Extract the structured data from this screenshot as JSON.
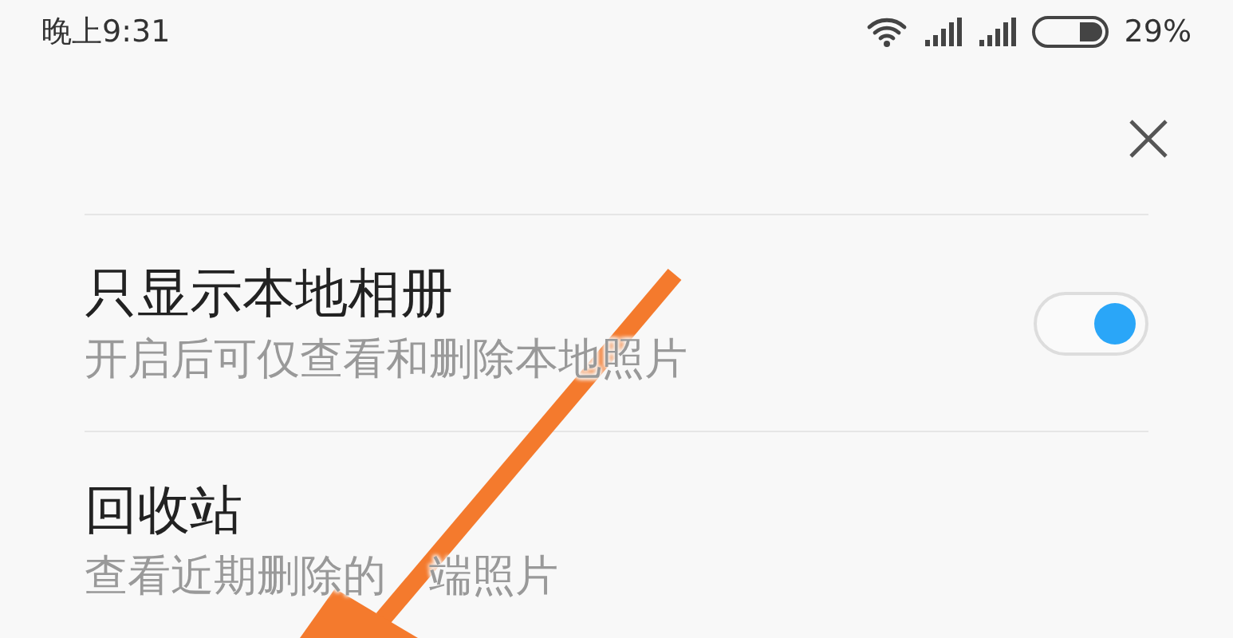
{
  "status_bar": {
    "time": "晚上9:31",
    "battery": "29%"
  },
  "settings": [
    {
      "title": "只显示本地相册",
      "subtitle": "开启后可仅查看和删除本地照片",
      "kind": "switch",
      "on": true
    },
    {
      "title": "回收站",
      "subtitle_parts": [
        "查看近期删除的",
        "端照片"
      ],
      "kind": "link"
    }
  ]
}
